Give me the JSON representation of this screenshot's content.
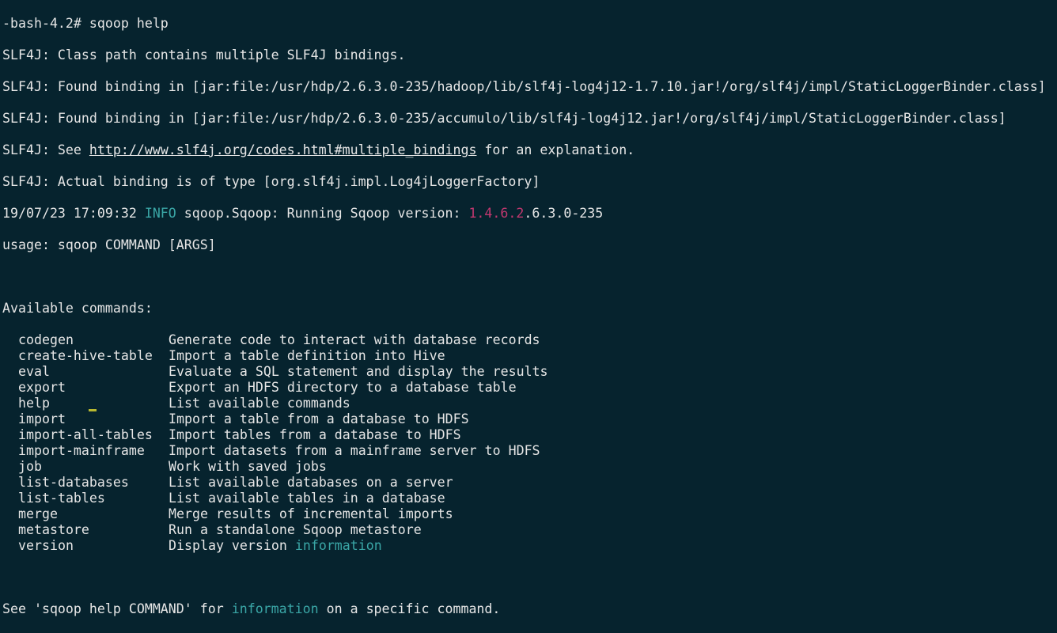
{
  "prompt": {
    "text": "-bash-4.2# sqoop help"
  },
  "slf4j": {
    "line1": "SLF4J: Class path contains multiple SLF4J bindings.",
    "line2": "SLF4J: Found binding in [jar:file:/usr/hdp/2.6.3.0-235/hadoop/lib/slf4j-log4j12-1.7.10.jar!/org/slf4j/impl/StaticLoggerBinder.class]",
    "line3": "SLF4J: Found binding in [jar:file:/usr/hdp/2.6.3.0-235/accumulo/lib/slf4j-log4j12.jar!/org/slf4j/impl/StaticLoggerBinder.class]",
    "line4_prefix": "SLF4J: See ",
    "line4_link": "http://www.slf4j.org/codes.html#multiple_bindings",
    "line4_suffix": " for an explanation.",
    "line5": "SLF4J: Actual binding is of type [org.slf4j.impl.Log4jLoggerFactory]"
  },
  "log": {
    "timestamp": "19/07/23 17:09:32 ",
    "level": "INFO",
    "message": " sqoop.Sqoop: Running Sqoop version: ",
    "version_highlight": "1.4.6.2",
    "version_rest": ".6.3.0-235"
  },
  "usage": "usage: sqoop COMMAND [ARGS]",
  "available_header": "Available commands:",
  "commands": [
    {
      "name": "codegen",
      "desc": "Generate code to interact with database records"
    },
    {
      "name": "create-hive-table",
      "desc": "Import a table definition into Hive"
    },
    {
      "name": "eval",
      "desc": "Evaluate a SQL statement and display the results"
    },
    {
      "name": "export",
      "desc": "Export an HDFS directory to a database table"
    },
    {
      "name": "help",
      "desc": "List available commands"
    },
    {
      "name": "import",
      "desc": "Import a table from a database to HDFS"
    },
    {
      "name": "import-all-tables",
      "desc": "Import tables from a database to HDFS"
    },
    {
      "name": "import-mainframe",
      "desc": "Import datasets from a mainframe server to HDFS"
    },
    {
      "name": "job",
      "desc": "Work with saved jobs"
    },
    {
      "name": "list-databases",
      "desc": "List available databases on a server"
    },
    {
      "name": "list-tables",
      "desc": "List available tables in a database"
    },
    {
      "name": "merge",
      "desc": "Merge results of incremental imports"
    },
    {
      "name": "metastore",
      "desc": "Run a standalone Sqoop metastore"
    },
    {
      "name": "version",
      "desc": "Display version ",
      "desc_highlight": "information"
    }
  ],
  "footer": {
    "prefix": "See 'sqoop help COMMAND' for ",
    "highlight": "information",
    "suffix": " on a specific command."
  },
  "colors": {
    "background": "#06232e",
    "foreground": "#e6e6e6",
    "info": "#3aa6a6",
    "version": "#c2386f",
    "cursor": "#b8b830"
  }
}
